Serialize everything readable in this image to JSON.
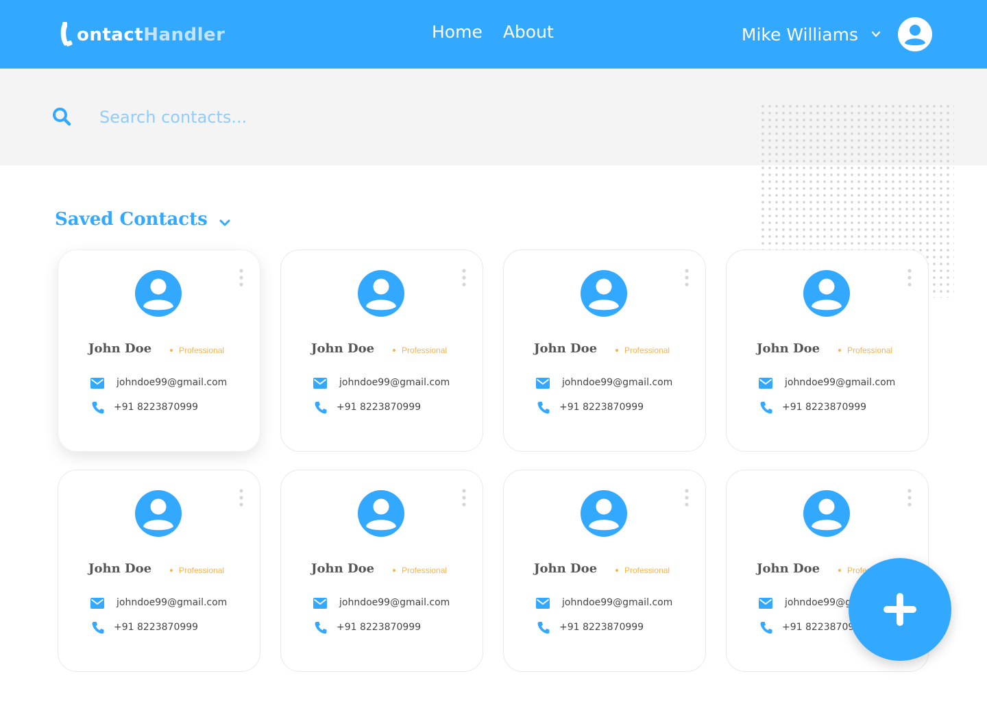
{
  "brand": {
    "logo_part1": "ontact",
    "logo_part2": "Handler"
  },
  "nav": {
    "home": "Home",
    "about": "About"
  },
  "user": {
    "name": "Mike Williams"
  },
  "search": {
    "placeholder": "Search contacts..."
  },
  "section": {
    "title": "Saved Contacts"
  },
  "contacts": [
    {
      "name": "John Doe",
      "category": "Professional",
      "email": "johndoe99@gmail.com",
      "phone": "+91 8223870999"
    },
    {
      "name": "John Doe",
      "category": "Professional",
      "email": "johndoe99@gmail.com",
      "phone": "+91 8223870999"
    },
    {
      "name": "John Doe",
      "category": "Professional",
      "email": "johndoe99@gmail.com",
      "phone": "+91 8223870999"
    },
    {
      "name": "John Doe",
      "category": "Professional",
      "email": "johndoe99@gmail.com",
      "phone": "+91 8223870999"
    },
    {
      "name": "John Doe",
      "category": "Professional",
      "email": "johndoe99@gmail.com",
      "phone": "+91 8223870999"
    },
    {
      "name": "John Doe",
      "category": "Professional",
      "email": "johndoe99@gmail.com",
      "phone": "+91 8223870999"
    },
    {
      "name": "John Doe",
      "category": "Professional",
      "email": "johndoe99@gmail.com",
      "phone": "+91 8223870999"
    },
    {
      "name": "John Doe",
      "category": "Professional",
      "email": "johndoe99@gmail.com",
      "phone": "+91 8223870999"
    }
  ],
  "colors": {
    "primary": "#33a8ff",
    "tag": "#f6b24e",
    "search_band": "#f4f4f4"
  },
  "icons": {
    "logo": "phone-handset-icon",
    "user_menu": "chevron-down-icon",
    "avatar": "user-avatar-icon",
    "search": "search-icon",
    "section_toggle": "chevron-down-icon",
    "card_menu": "kebab-menu-icon",
    "email": "envelope-icon",
    "phone": "phone-icon",
    "add": "plus-icon"
  }
}
